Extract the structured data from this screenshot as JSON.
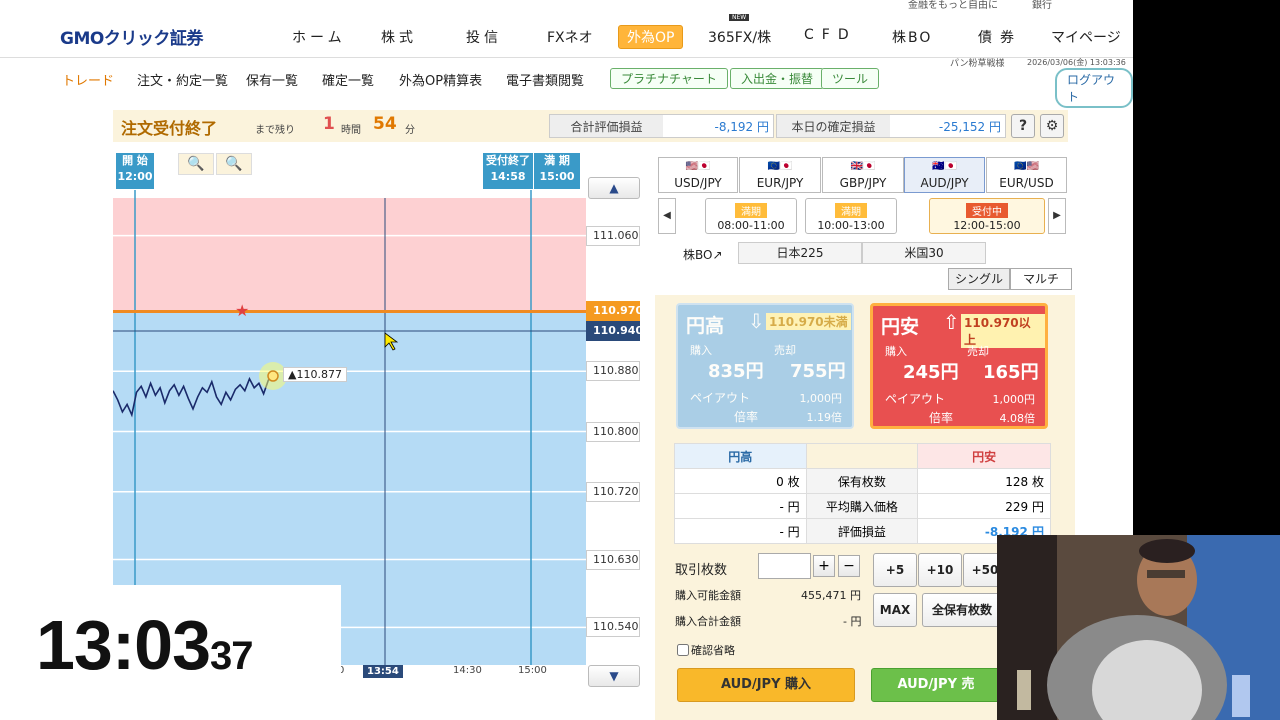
{
  "top_strip": {
    "left_text": "金融をもっと自由に",
    "right_text": "銀行"
  },
  "header": {
    "logo": "GMOクリック証券",
    "nav": [
      "ホーム",
      "株式",
      "投信",
      "FXネオ",
      "外為OP",
      "365FX/株",
      "CFD",
      "株BO",
      "債券",
      "マイページ"
    ],
    "active_nav": "外為OP",
    "new_badge": "NEW"
  },
  "subnav": {
    "items": [
      "トレード",
      "注文・約定一覧",
      "保有一覧",
      "確定一覧",
      "外為OP精算表",
      "電子書類閲覧"
    ],
    "buttons": [
      "プラチナチャート",
      "入出金・振替",
      "ツール"
    ],
    "logout": "ログアウト",
    "user": "パン粉草戦様",
    "datetime": "2026/03/06(金) 13:03:36"
  },
  "status": {
    "title": "注文受付終了",
    "remain_label": "まで残り",
    "hours": "1",
    "hours_label": "時間",
    "minutes": "54",
    "minutes_label": "分",
    "eval_label": "合計評価損益",
    "eval_value": "-8,192 円",
    "today_label": "本日の確定損益",
    "today_value": "-25,152 円",
    "help_icon": "?",
    "settings_icon": "gear-icon"
  },
  "chart": {
    "zoom_out": "−",
    "zoom_in": "+",
    "start_tag": [
      "開 始",
      "12:00"
    ],
    "end_tag": [
      "受付終了",
      "14:58"
    ],
    "expiry_tag": [
      "満 期",
      "15:00"
    ],
    "up_arrow": "▲",
    "down_arrow": "▼",
    "strike_label": "110.970",
    "current_label": "110.940",
    "last_label": "▲110.877"
  },
  "chart_data": {
    "type": "line",
    "title": "",
    "xlabel": "",
    "ylabel": "",
    "y_ticks": [
      "111.060",
      "110.880",
      "110.800",
      "110.720",
      "110.630",
      "110.540"
    ],
    "x_ticks": [
      "0",
      "13:54",
      "14:30",
      "15:00"
    ],
    "ylim": [
      110.49,
      111.11
    ],
    "strike": 110.97,
    "current": 110.94,
    "last_price": 110.877,
    "series": [
      {
        "values": [
          110.854,
          110.842,
          110.826,
          110.836,
          110.822,
          110.852,
          110.86,
          110.846,
          110.864,
          110.848,
          110.858,
          110.838,
          110.854,
          110.862,
          110.848,
          110.86,
          110.844,
          110.83,
          110.846,
          110.858,
          110.852,
          110.866,
          110.846,
          110.836,
          110.852,
          110.842,
          110.856,
          110.862,
          110.854,
          110.87,
          110.858,
          110.864,
          110.85,
          110.868,
          110.877
        ]
      }
    ]
  },
  "right": {
    "pairs": [
      {
        "name": "USD/JPY",
        "flags": "🇺🇸🇯🇵"
      },
      {
        "name": "EUR/JPY",
        "flags": "🇪🇺🇯🇵"
      },
      {
        "name": "GBP/JPY",
        "flags": "🇬🇧🇯🇵"
      },
      {
        "name": "AUD/JPY",
        "flags": "🇦🇺🇯🇵"
      },
      {
        "name": "EUR/USD",
        "flags": "🇪🇺🇺🇸"
      }
    ],
    "selected_pair": "AUD/JPY",
    "sessions": [
      {
        "status": "満期",
        "time": "08:00-11:00"
      },
      {
        "status": "満期",
        "time": "10:00-13:00"
      },
      {
        "status": "受付中",
        "time": "12:00-15:00"
      }
    ],
    "kabubo": "株BO↗",
    "indices": [
      "日本225",
      "米国30"
    ],
    "modes": [
      "シングル",
      "マルチ"
    ],
    "high_card": {
      "title": "円高",
      "cond": "110.970未満",
      "buy_label": "購入",
      "buy": "835円",
      "sell_label": "売却",
      "sell": "755円",
      "payout_label": "ペイアウト",
      "payout": "1,000円",
      "rate_label": "倍率",
      "rate": "1.19倍"
    },
    "low_card": {
      "title": "円安",
      "cond": "110.970以上",
      "buy_label": "購入",
      "buy": "245円",
      "sell_label": "売却",
      "sell": "165円",
      "payout_label": "ペイアウト",
      "payout": "1,000円",
      "rate_label": "倍率",
      "rate": "4.08倍"
    },
    "positions": {
      "col_high": "円高",
      "col_low": "円安",
      "rows": [
        {
          "high": "0 枚",
          "label": "保有枚数",
          "low": "128 枚"
        },
        {
          "high": "- 円",
          "label": "平均購入価格",
          "low": "229 円"
        },
        {
          "high": "- 円",
          "label": "評価損益",
          "low": "-8,192 円"
        }
      ]
    },
    "qty_label": "取引枚数",
    "qty_value": "",
    "plus": "+",
    "minus": "−",
    "quick": [
      "+5",
      "+10",
      "+50"
    ],
    "max": "MAX",
    "all": "全保有枚数",
    "available_label": "購入可能金額",
    "available_value": "455,471 円",
    "total_label": "購入合計金額",
    "total_value": "- 円",
    "confirm_skip": "確認省略",
    "buy_high": "AUD/JPY 購入",
    "buy_low": "AUD/JPY 売"
  },
  "overlay": {
    "clock_main": "13:03",
    "clock_sec": "37"
  }
}
